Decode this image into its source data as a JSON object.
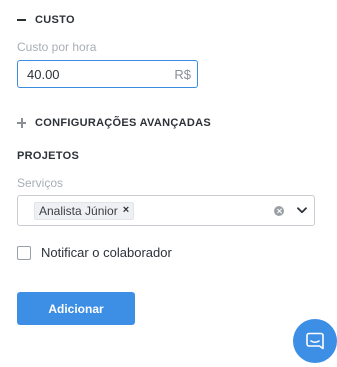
{
  "cost_section": {
    "toggle_label": "CUSTO",
    "expanded": true,
    "field_label": "Custo por hora",
    "value": "40.00",
    "currency_suffix": "R$"
  },
  "advanced_section": {
    "toggle_label": "CONFIGURAÇÕES AVANÇADAS",
    "expanded": false
  },
  "projects_section": {
    "title": "PROJETOS",
    "field_label": "Serviços",
    "selected_tags": [
      {
        "label": "Analista Júnior",
        "remove_glyph": "×"
      }
    ]
  },
  "notify": {
    "label": "Notificar o colaborador",
    "checked": false
  },
  "actions": {
    "add_label": "Adicionar"
  },
  "icons": {
    "collapse": "minus-icon",
    "expand": "plus-icon",
    "clear": "clear-circle-icon",
    "dropdown": "chevron-down-icon",
    "chat": "chat-bubble-icon"
  },
  "colors": {
    "accent": "#3d8ee5",
    "input_focus_border": "#3b8ce3",
    "label_muted": "#a9aeb4",
    "text": "#2d3238"
  }
}
